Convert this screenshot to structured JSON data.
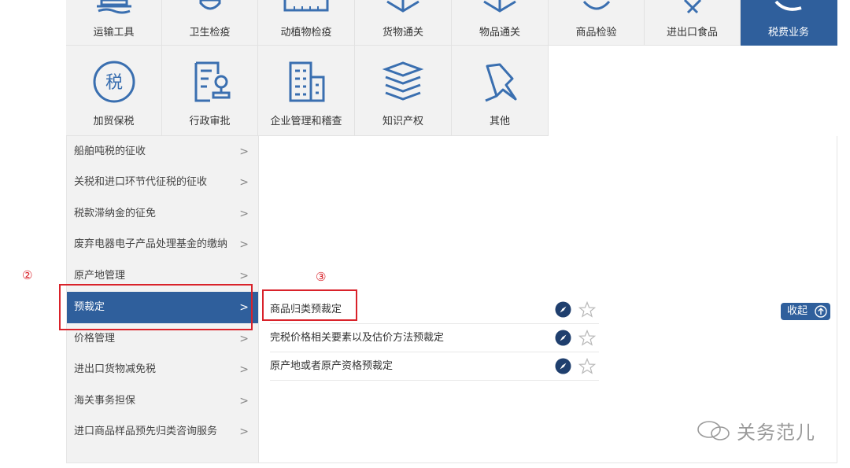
{
  "categories_row1": [
    {
      "label": "运输工具",
      "icon": "ship-icon"
    },
    {
      "label": "卫生检疫",
      "icon": "health-quarantine-icon"
    },
    {
      "label": "动植物检疫",
      "icon": "plant-animal-icon"
    },
    {
      "label": "货物通关",
      "icon": "cargo-box-icon"
    },
    {
      "label": "物品通关",
      "icon": "parcel-box-icon"
    },
    {
      "label": "商品检验",
      "icon": "inspection-icon"
    },
    {
      "label": "进出口食品",
      "icon": "food-icon"
    },
    {
      "label": "税费业务",
      "icon": "tax-fee-icon"
    }
  ],
  "categories_row2": [
    {
      "label": "加贸保税",
      "icon": "tax-circle-icon"
    },
    {
      "label": "行政审批",
      "icon": "admin-approval-icon"
    },
    {
      "label": "企业管理和稽查",
      "icon": "building-icon"
    },
    {
      "label": "知识产权",
      "icon": "books-icon"
    },
    {
      "label": "其他",
      "icon": "pin-icon"
    }
  ],
  "left_menu": [
    "船舶吨税的征收",
    "关税和进口环节代征税的征收",
    "税款滞纳金的征免",
    "废弃电器电子产品处理基金的缴纳",
    "原产地管理",
    "预裁定",
    "价格管理",
    "进出口货物减免税",
    "海关事务担保",
    "进口商品样品预先归类咨询服务"
  ],
  "chevron": ">",
  "sub_menu": [
    "商品归类预裁定",
    "完税价格相关要素以及估价方法预裁定",
    "原产地或者原产资格预裁定"
  ],
  "collapse_label": "收起",
  "annotations": {
    "marker_2": "②",
    "marker_3": "③"
  },
  "watermark": "关务范儿",
  "colors": {
    "accent": "#2f5f9c",
    "annotation": "#d9222a",
    "tile_bg": "#f2f2f2"
  }
}
